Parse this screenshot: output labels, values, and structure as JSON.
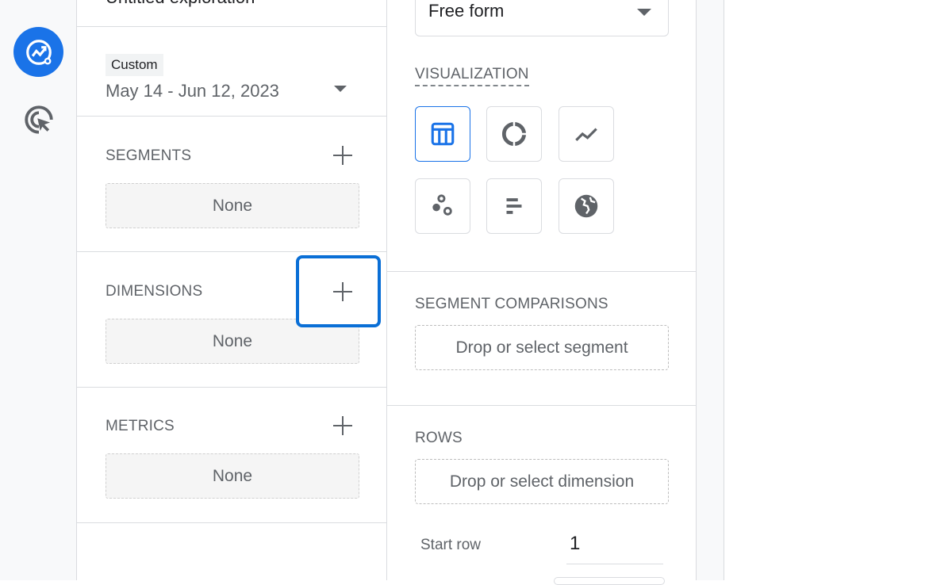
{
  "title": "Untitled exploration",
  "rail": {
    "items": [
      {
        "icon": "explore-icon",
        "active": true
      },
      {
        "icon": "cursor-target-icon",
        "active": false
      }
    ]
  },
  "date": {
    "badge": "Custom",
    "range": "May 14 - Jun 12, 2023"
  },
  "segments": {
    "label": "SEGMENTS",
    "value": "None"
  },
  "dimensions": {
    "label": "DIMENSIONS",
    "value": "None"
  },
  "metrics": {
    "label": "METRICS",
    "value": "None"
  },
  "technique": {
    "value": "Free form"
  },
  "visualization": {
    "label": "VISUALIZATION",
    "options": [
      "table-icon",
      "donut-chart-icon",
      "line-chart-icon",
      "scatter-plot-icon",
      "bar-chart-icon",
      "globe-icon"
    ],
    "selected": "table-icon"
  },
  "segment_comparisons": {
    "label": "SEGMENT COMPARISONS",
    "placeholder": "Drop or select segment"
  },
  "rows": {
    "label": "ROWS",
    "placeholder": "Drop or select dimension",
    "start_row_label": "Start row",
    "start_row_value": "1"
  },
  "colors": {
    "accent": "#1a73e8",
    "highlight": "#0a6fd6"
  }
}
